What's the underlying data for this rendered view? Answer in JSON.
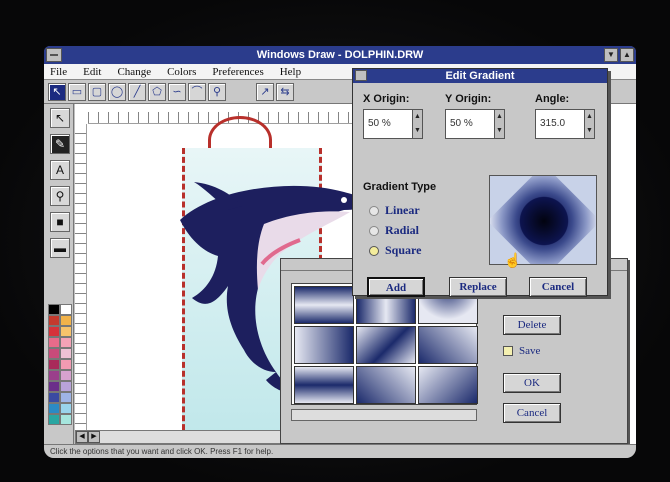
{
  "app": {
    "title": "Windows Draw - DOLPHIN.DRW"
  },
  "menu": [
    "File",
    "Edit",
    "Change",
    "Colors",
    "Preferences",
    "Help"
  ],
  "edit_gradient": {
    "title": "Edit Gradient",
    "x_origin_label": "X Origin:",
    "y_origin_label": "Y Origin:",
    "angle_label": "Angle:",
    "x_origin_value": "50 %",
    "y_origin_value": "50 %",
    "angle_value": "315.0",
    "gradient_type_label": "Gradient Type",
    "options": [
      "Linear",
      "Radial",
      "Square"
    ],
    "selected_option": "Square",
    "add_label": "Add",
    "replace_label": "Replace",
    "cancel_label": "Cancel"
  },
  "gradient_library": {
    "delete_label": "Delete",
    "save_label": "Save",
    "ok_label": "OK",
    "cancel_label": "Cancel"
  },
  "status": {
    "text": "Click the options that you want and click OK. Press F1 for help."
  },
  "colors": {
    "titlebar": "#2b3c8c",
    "gradient_dark": "#1b2a6b",
    "gradient_light": "#e6e8f2",
    "palette": [
      "#000000",
      "#ffffff",
      "#c43a2e",
      "#f2b34a",
      "#d6323a",
      "#f7c36b",
      "#e86b8a",
      "#f4a2b6",
      "#c84b7a",
      "#eec1d4",
      "#a92a5a",
      "#f29ab2",
      "#9a3f8b",
      "#d7a2cf",
      "#6b2f8a",
      "#b9a3da",
      "#3a4aa2",
      "#9fb4e6",
      "#2b8ac4",
      "#9ad4ec",
      "#2aa6a2",
      "#a6e6de"
    ]
  }
}
